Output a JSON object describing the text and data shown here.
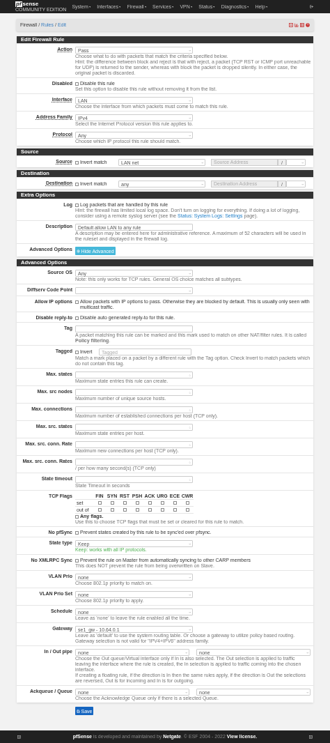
{
  "navbar": {
    "logo_mark": "pf",
    "logo_word": "sense",
    "logo_sub": "COMMUNITY EDITION",
    "menus": [
      "System",
      "Interfaces",
      "Firewall",
      "Services",
      "VPN",
      "Status",
      "Diagnostics",
      "Help"
    ]
  },
  "breadcrumb": {
    "separator": "/",
    "items": [
      {
        "label": "Firewall",
        "link": false
      },
      {
        "label": "Rules",
        "link": true
      },
      {
        "label": "Edit",
        "link": true
      }
    ]
  },
  "sections": [
    {
      "title": "Edit Firewall Rule",
      "rows": [
        {
          "kind": "select",
          "label": "Action",
          "required": true,
          "value": "Pass",
          "help": [
            "Choose what to do with packets that match the criteria specified below.",
            "Hint: the difference between block and reject is that with reject, a packet (TCP RST or ICMP port unreachable for UDP) is returned to the sender, whereas with block the packet is dropped silently. In either case, the original packet is discarded."
          ]
        },
        {
          "kind": "checkbox",
          "label": "Disabled",
          "required": false,
          "checked": false,
          "text": "Disable this rule",
          "help": [
            "Set this option to disable this rule without removing it from the list."
          ]
        },
        {
          "kind": "select",
          "label": "Interface",
          "required": true,
          "value": "LAN",
          "help": [
            "Choose the interface from which packets must come to match this rule."
          ]
        },
        {
          "kind": "select",
          "label": "Address Family",
          "required": true,
          "value": "IPv4",
          "help": [
            "Select the Internet Protocol version this rule applies to."
          ]
        },
        {
          "kind": "select",
          "label": "Protocol",
          "required": true,
          "value": "Any",
          "help": [
            "Choose which IP protocol this rule should match."
          ]
        }
      ]
    },
    {
      "title": "Source",
      "rows": [
        {
          "kind": "address",
          "label": "Source",
          "required": true,
          "checked": false,
          "text": "Invert match",
          "value": "LAN net",
          "address": {
            "placeholder": "Source Address",
            "disabled": true
          },
          "separator": "/"
        }
      ]
    },
    {
      "title": "Destination",
      "rows": [
        {
          "kind": "address",
          "label": "Destination",
          "required": true,
          "checked": false,
          "text": "Invert match",
          "value": "any",
          "address": {
            "placeholder": "Destination Address",
            "disabled": true
          },
          "separator": "/"
        }
      ]
    },
    {
      "title": "Extra Options",
      "rows": [
        {
          "kind": "checkbox",
          "label": "Log",
          "required": false,
          "checked": false,
          "text": "Log packets that are handled by this rule",
          "help": [
            {
              "parts": [
                {
                  "text": "Hint: the firewall has limited local log space. Don't turn on logging for everything. If doing a lot of logging, consider using a remote syslog server (see the "
                },
                {
                  "text": "Status: System Logs: Settings",
                  "link": true
                },
                {
                  "text": " page)."
                }
              ]
            }
          ]
        },
        {
          "kind": "text",
          "label": "Description",
          "required": false,
          "value": "Default allow LAN to any rule",
          "help": [
            "A description may be entered here for administrative reference. A maximum of 52 characters will be used in the ruleset and displayed in the firewall log."
          ]
        },
        {
          "kind": "button",
          "label": "Advanced Options",
          "required": false,
          "text": "Hide Advanced"
        }
      ]
    },
    {
      "title": "Advanced Options",
      "rows": [
        {
          "kind": "select",
          "label": "Source OS",
          "required": false,
          "value": "Any",
          "help": [
            "Note: this only works for TCP rules. General OS choice matches all subtypes."
          ]
        },
        {
          "kind": "select",
          "label": "Diffserv Code Point",
          "required": false
        },
        {
          "kind": "checkbox",
          "label": "Allow IP options",
          "required": false,
          "checked": false,
          "text": "Allow packets with IP options to pass. Otherwise they are blocked by default. This is usually only seen with multicast traffic."
        },
        {
          "kind": "checkbox",
          "label": "Disable reply-to",
          "required": false,
          "checked": false,
          "text": "Disable auto generated reply-to for this rule."
        },
        {
          "kind": "text",
          "label": "Tag",
          "required": false,
          "help": [
            "A packet matching this rule can be marked and this mark used to match on other NAT/filter rules. It is called **Policy filtering**."
          ]
        },
        {
          "kind": "tagged",
          "label": "Tagged",
          "required": false,
          "checked": false,
          "text": "Invert",
          "placeholder": "Tagged",
          "help": [
            "Match a mark placed on a packet by a different rule with the Tag option. Check Invert to match packets which do not contain this tag."
          ]
        },
        {
          "kind": "number",
          "label": "Max. states",
          "required": false,
          "help": [
            "Maximum state entries this rule can create."
          ]
        },
        {
          "kind": "number",
          "label": "Max. src nodes",
          "required": false,
          "help": [
            "Maximum number of unique source hosts."
          ]
        },
        {
          "kind": "number",
          "label": "Max. connections",
          "required": false,
          "help": [
            "Maximum number of established connections per host (TCP only)."
          ]
        },
        {
          "kind": "number",
          "label": "Max. src. states",
          "required": false,
          "help": [
            "Maximum state entries per host."
          ]
        },
        {
          "kind": "number",
          "label": "Max. src. conn. Rate",
          "required": false,
          "help": [
            "Maximum new connections per host (TCP only)."
          ]
        },
        {
          "kind": "number",
          "label": "Max. src. conn. Rates",
          "required": false,
          "help": [
            "/ per how many second(s) (TCP only)"
          ]
        },
        {
          "kind": "number",
          "label": "State timeout",
          "required": false,
          "help": [
            "State Timeout in seconds"
          ]
        },
        {
          "kind": "flags",
          "label": "TCP Flags",
          "required": false,
          "flags": [
            "FIN",
            "SYN",
            "RST",
            "PSH",
            "ACK",
            "URG",
            "ECE",
            "CWR"
          ],
          "flag_rows": [
            {
              "label": "set",
              "boxes": [
                {
                  "checked": false
                },
                {
                  "checked": false
                },
                {
                  "checked": false
                },
                {
                  "checked": false
                },
                {
                  "checked": false
                },
                {
                  "checked": false
                },
                {
                  "checked": false
                },
                {
                  "checked": false
                }
              ]
            },
            {
              "label": "out of",
              "boxes": [
                {
                  "checked": false
                },
                {
                  "checked": false
                },
                {
                  "checked": false
                },
                {
                  "checked": false
                },
                {
                  "checked": false
                },
                {
                  "checked": false
                },
                {
                  "checked": false
                },
                {
                  "checked": false
                }
              ]
            }
          ],
          "any": {
            "text": "Any flags.",
            "checked": false
          },
          "help": [
            "Use this to choose TCP flags that must be set or cleared for this rule to match."
          ]
        },
        {
          "kind": "checkbox",
          "label": "No pfSync",
          "required": false,
          "checked": false,
          "text": "Prevent states created by this rule to be sync'ed over pfsync."
        },
        {
          "kind": "select",
          "label": "State type",
          "required": false,
          "value": "Keep",
          "help_success": true,
          "help": [
            "Keep: works with all IP protocols."
          ]
        },
        {
          "kind": "checkbox",
          "label": "No XMLRPC Sync",
          "required": false,
          "checked": false,
          "text": "Prevent the rule on Master from automatically syncing to other CARP members",
          "help": [
            "This does NOT prevent the rule from being overwritten on Slave."
          ]
        },
        {
          "kind": "select",
          "label": "VLAN Prio",
          "required": false,
          "value": "none",
          "help": [
            "Choose 802.1p priority to match on."
          ]
        },
        {
          "kind": "select",
          "label": "VLAN Prio Set",
          "required": false,
          "value": "none",
          "help": [
            "Choose 802.1p priority to apply."
          ]
        },
        {
          "kind": "select",
          "label": "Schedule",
          "required": false,
          "value": "none",
          "help": [
            "Leave as 'none' to leave the rule enabled all the time."
          ]
        },
        {
          "kind": "select",
          "label": "Gateway",
          "required": false,
          "value": "se1_gw - 10.64.0.1",
          "help": [
            "Leave as 'default' to use the system routing table. Or choose a gateway to utilize policy based routing.",
            "Gateway selection is not valid for \"IPV4+IPV6\" address family."
          ]
        },
        {
          "kind": "dual_select",
          "label": "In / Out pipe",
          "required": false,
          "values": [
            "none",
            "none"
          ],
          "help": [
            "Choose the Out queue/Virtual interface only if In is also selected. The Out selection is applied to traffic leaving the interface where the rule is created, the In selection is applied to traffic coming into the chosen interface.",
            "If creating a floating rule, if the direction is In then the same rules apply, if the direction is Out the selections are reversed, Out is for incoming and In is for outgoing."
          ]
        },
        {
          "kind": "dual_select",
          "label": "Ackqueue / Queue",
          "required": false,
          "values": [
            "none",
            "none"
          ],
          "help": [
            "Choose the Acknowledge Queue only if there is a selected Queue."
          ]
        }
      ]
    }
  ],
  "save_button": "Save",
  "footer": [
    {
      "text": "pfSense",
      "link": true
    },
    {
      "text": " is developed and maintained by "
    },
    {
      "text": "Netgate",
      "link": true
    },
    {
      "text": ". © ESF 2004 - 2022 "
    },
    {
      "text": "View license.",
      "link": true
    }
  ]
}
